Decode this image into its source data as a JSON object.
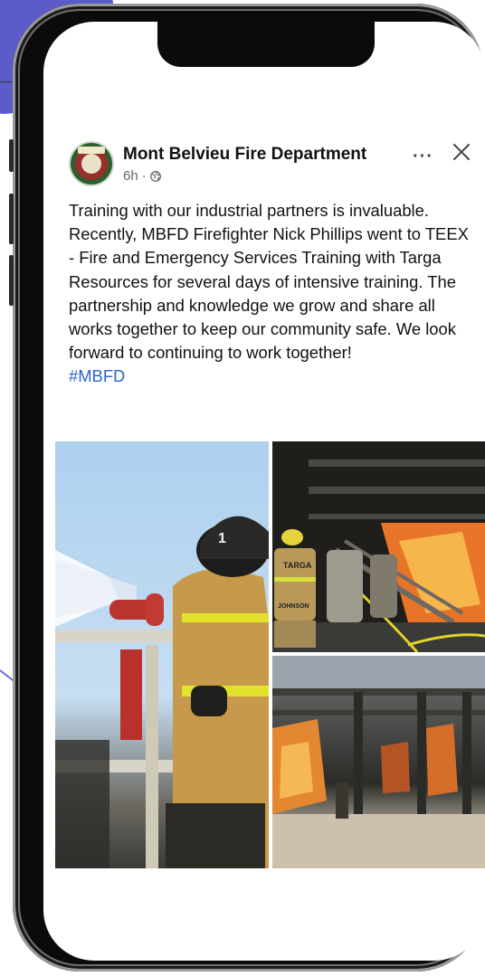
{
  "post": {
    "page_name": "Mont Belvieu Fire Department",
    "time": "6h",
    "separator": "·",
    "more_icon": "more-horizontal-icon",
    "close_icon": "close-icon",
    "audience_icon": "globe-icon",
    "body": "Training with our industrial partners is invaluable. Recently, MBFD Firefighter Nick Phillips went to TEEX - Fire and Emergency Services Training with Targa Resources for several days of intensive training. The partnership and knowledge we grow and share all works together to keep our community safe. We look forward to continuing to work together!",
    "hashtag": "#MBFD",
    "photo_labels": {
      "helmet_number": "1",
      "coat_label_1": "TARGA",
      "coat_label_2": "JOHNSON"
    }
  },
  "colors": {
    "hashtag": "#2c64d0",
    "meta": "#65676b",
    "phone_frame": "#0b0b0b"
  }
}
